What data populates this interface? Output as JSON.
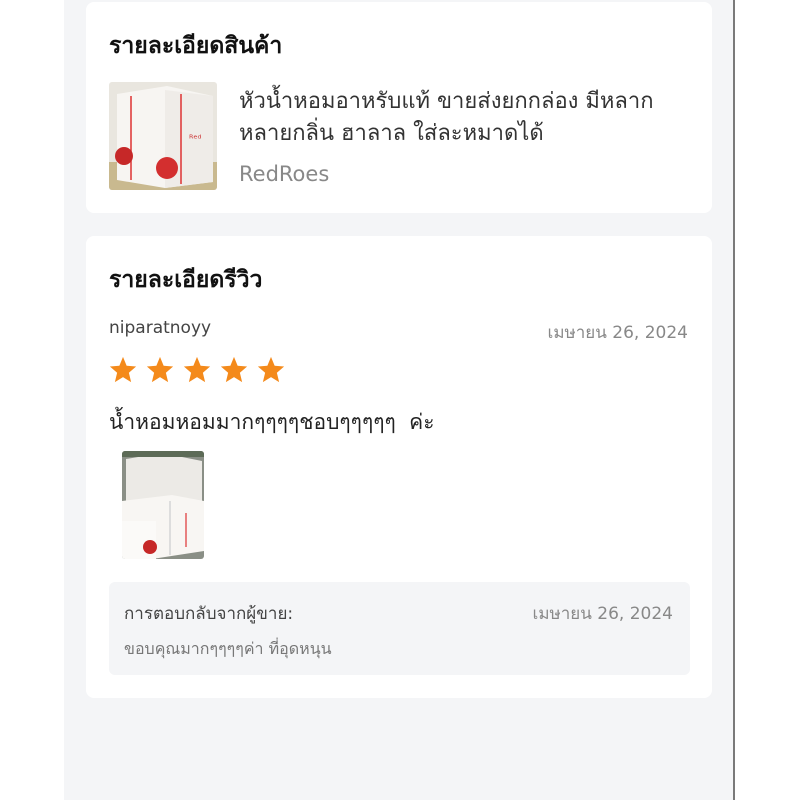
{
  "product_section": {
    "title": "รายละเอียดสินค้า",
    "product_name": "หัวน้ำหอมอาหรับแท้ ขายส่งยกกล่อง มีหลากหลายกลิ่น ฮาลาล ใส่ละหมาดได้",
    "brand": "RedRoes"
  },
  "review_section": {
    "title": "รายละเอียดรีวิว",
    "reviewer": "niparatnoyy",
    "date": "เมษายน 26, 2024",
    "rating": 5,
    "star_color": "#f48a1b",
    "text": "น้ำหอมหอมมากๆๆๆๆชอบๆๆๆๆๆ  ค่ะ",
    "reply": {
      "label": "การตอบกลับจากผู้ขาย:",
      "date": "เมษายน 26, 2024",
      "text": "ขอบคุณมากๆๆๆๆค่า ที่อุดหนุน"
    }
  }
}
